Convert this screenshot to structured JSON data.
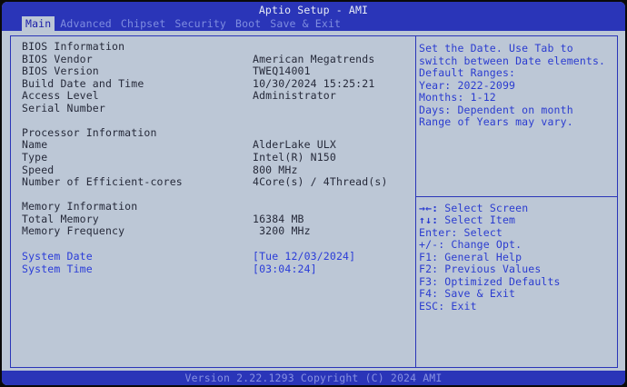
{
  "header": {
    "title": "Aptio Setup - AMI",
    "tabs": [
      "Main",
      "Advanced",
      "Chipset",
      "Security",
      "Boot",
      "Save & Exit"
    ],
    "active_tab": "Main"
  },
  "main": {
    "bios_info": {
      "heading": "BIOS Information",
      "vendor_label": "BIOS Vendor",
      "vendor_value": "American Megatrends",
      "version_label": "BIOS Version",
      "version_value": "TWEQ14001",
      "build_label": "Build Date and Time",
      "build_value": "10/30/2024 15:25:21",
      "access_label": "Access Level",
      "access_value": "Administrator",
      "serial_label": "Serial Number",
      "serial_value": ""
    },
    "processor_info": {
      "heading": "Processor Information",
      "name_label": "Name",
      "name_value": "AlderLake ULX",
      "type_label": "Type",
      "type_value": "Intel(R) N150",
      "speed_label": "Speed",
      "speed_value": "800 MHz",
      "cores_label": "Number of Efficient-cores",
      "cores_value": "4Core(s) / 4Thread(s)"
    },
    "memory_info": {
      "heading": "Memory Information",
      "total_label": "Total Memory",
      "total_value": "16384 MB",
      "freq_label": "Memory Frequency",
      "freq_value": " 3200 MHz"
    },
    "system_date": {
      "label": "System Date",
      "value": "[Tue 12/03/2024]"
    },
    "system_time": {
      "label": "System Time",
      "value": "[03:04:24]"
    }
  },
  "help": {
    "description": [
      "Set the Date. Use Tab to",
      "switch between Date elements.",
      "Default Ranges:",
      "Year: 2022-2099",
      "Months: 1-12",
      "Days: Dependent on month",
      "Range of Years may vary."
    ],
    "keys": [
      {
        "key": "→←:",
        "desc": " Select Screen"
      },
      {
        "key": "↑↓:",
        "desc": " Select Item"
      },
      {
        "key": "Enter:",
        "desc": " Select"
      },
      {
        "key": "+/-:",
        "desc": " Change Opt."
      },
      {
        "key": "F1:",
        "desc": " General Help"
      },
      {
        "key": "F2:",
        "desc": " Previous Values"
      },
      {
        "key": "F3:",
        "desc": " Optimized Defaults"
      },
      {
        "key": "F4:",
        "desc": " Save & Exit"
      },
      {
        "key": "ESC:",
        "desc": " Exit"
      }
    ]
  },
  "footer": {
    "version": "Version 2.22.1293 Copyright (C) 2024 AMI"
  },
  "colors": {
    "bar": "#2a35b8",
    "panel": "#bcc7d6",
    "text": "#262a3a",
    "highlight": "#2a3cd8"
  }
}
